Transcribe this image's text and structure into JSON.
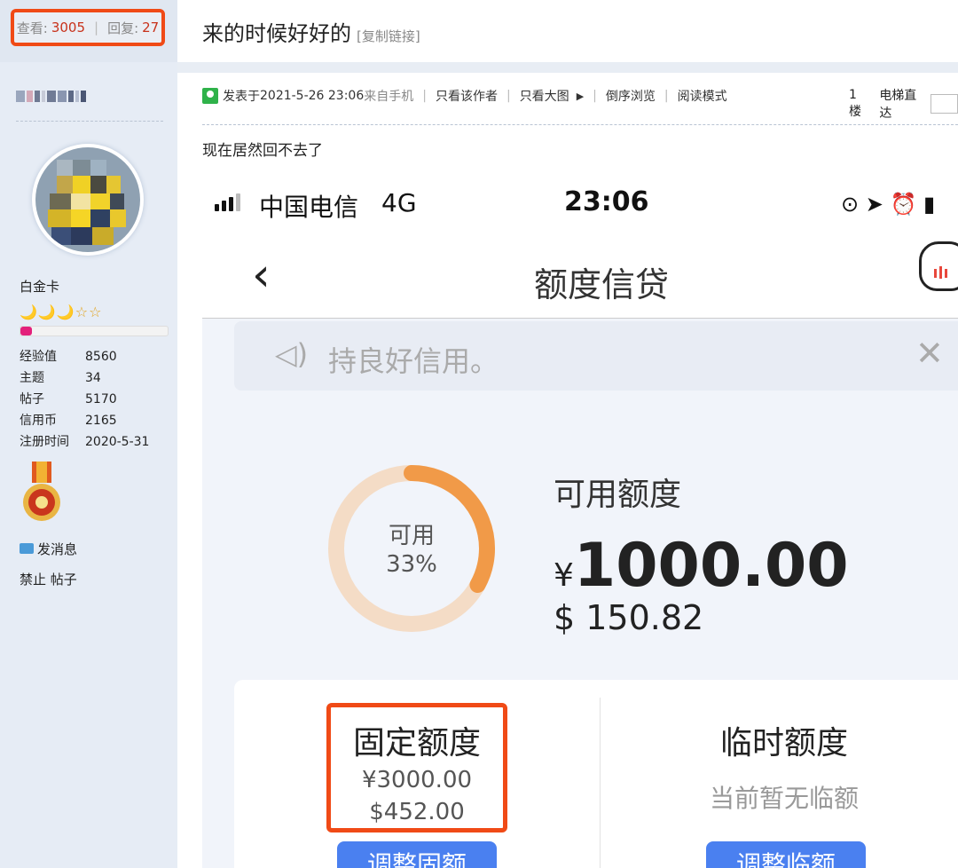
{
  "thread": {
    "views_label": "查看:",
    "views": "3005",
    "replies_label": "回复:",
    "replies": "27",
    "title": "来的时候好好的",
    "copy_link": "[复制链接]"
  },
  "user": {
    "group": "白金卡",
    "stars": "🌙🌙🌙☆☆",
    "progress": 0.08,
    "stats": [
      {
        "k": "经验值",
        "v": "8560"
      },
      {
        "k": "主题",
        "v": "34"
      },
      {
        "k": "帖子",
        "v": "5170"
      },
      {
        "k": "信用币",
        "v": "2165"
      },
      {
        "k": "注册时间",
        "v": "2020-5-31"
      }
    ],
    "send_message": "发消息",
    "ban": "禁止 帖子"
  },
  "post": {
    "posted_prefix": "发表于 ",
    "posted_time": "2021-5-26 23:06",
    "source": " 来自手机",
    "only_author": "只看该作者",
    "big_image": "只看大图",
    "reverse": "倒序浏览",
    "reading_mode": "阅读模式",
    "floor": "1楼",
    "elevator": "电梯直达",
    "text": "现在居然回不去了"
  },
  "phone": {
    "carrier": "中国电信",
    "network": "4G",
    "time": "23:06",
    "status_icons": "⊙ ➤ ⏰ ▮",
    "nav_back": "‹",
    "nav_title": "额度信贷",
    "notice_text": "持良好信用。",
    "notice_close": "✕",
    "ring_label_1": "可用",
    "ring_label_2": "33%",
    "ring_fraction": 0.33,
    "available_label": "可用额度",
    "currency_symbol": "¥",
    "available_cny": "1000.00",
    "available_usd": "$ 150.82",
    "fixed_label": "固定额度",
    "fixed_cny": "¥3000.00",
    "fixed_usd": "$452.00",
    "temp_label": "临时额度",
    "temp_none": "当前暂无临额",
    "btn_fixed": "调整固额",
    "btn_temp": "调整临额"
  },
  "colors": {
    "highlight": "#f04a16",
    "ring_active": "#f19a48",
    "ring_track": "#f4dcc6",
    "button": "#4a80f0"
  }
}
